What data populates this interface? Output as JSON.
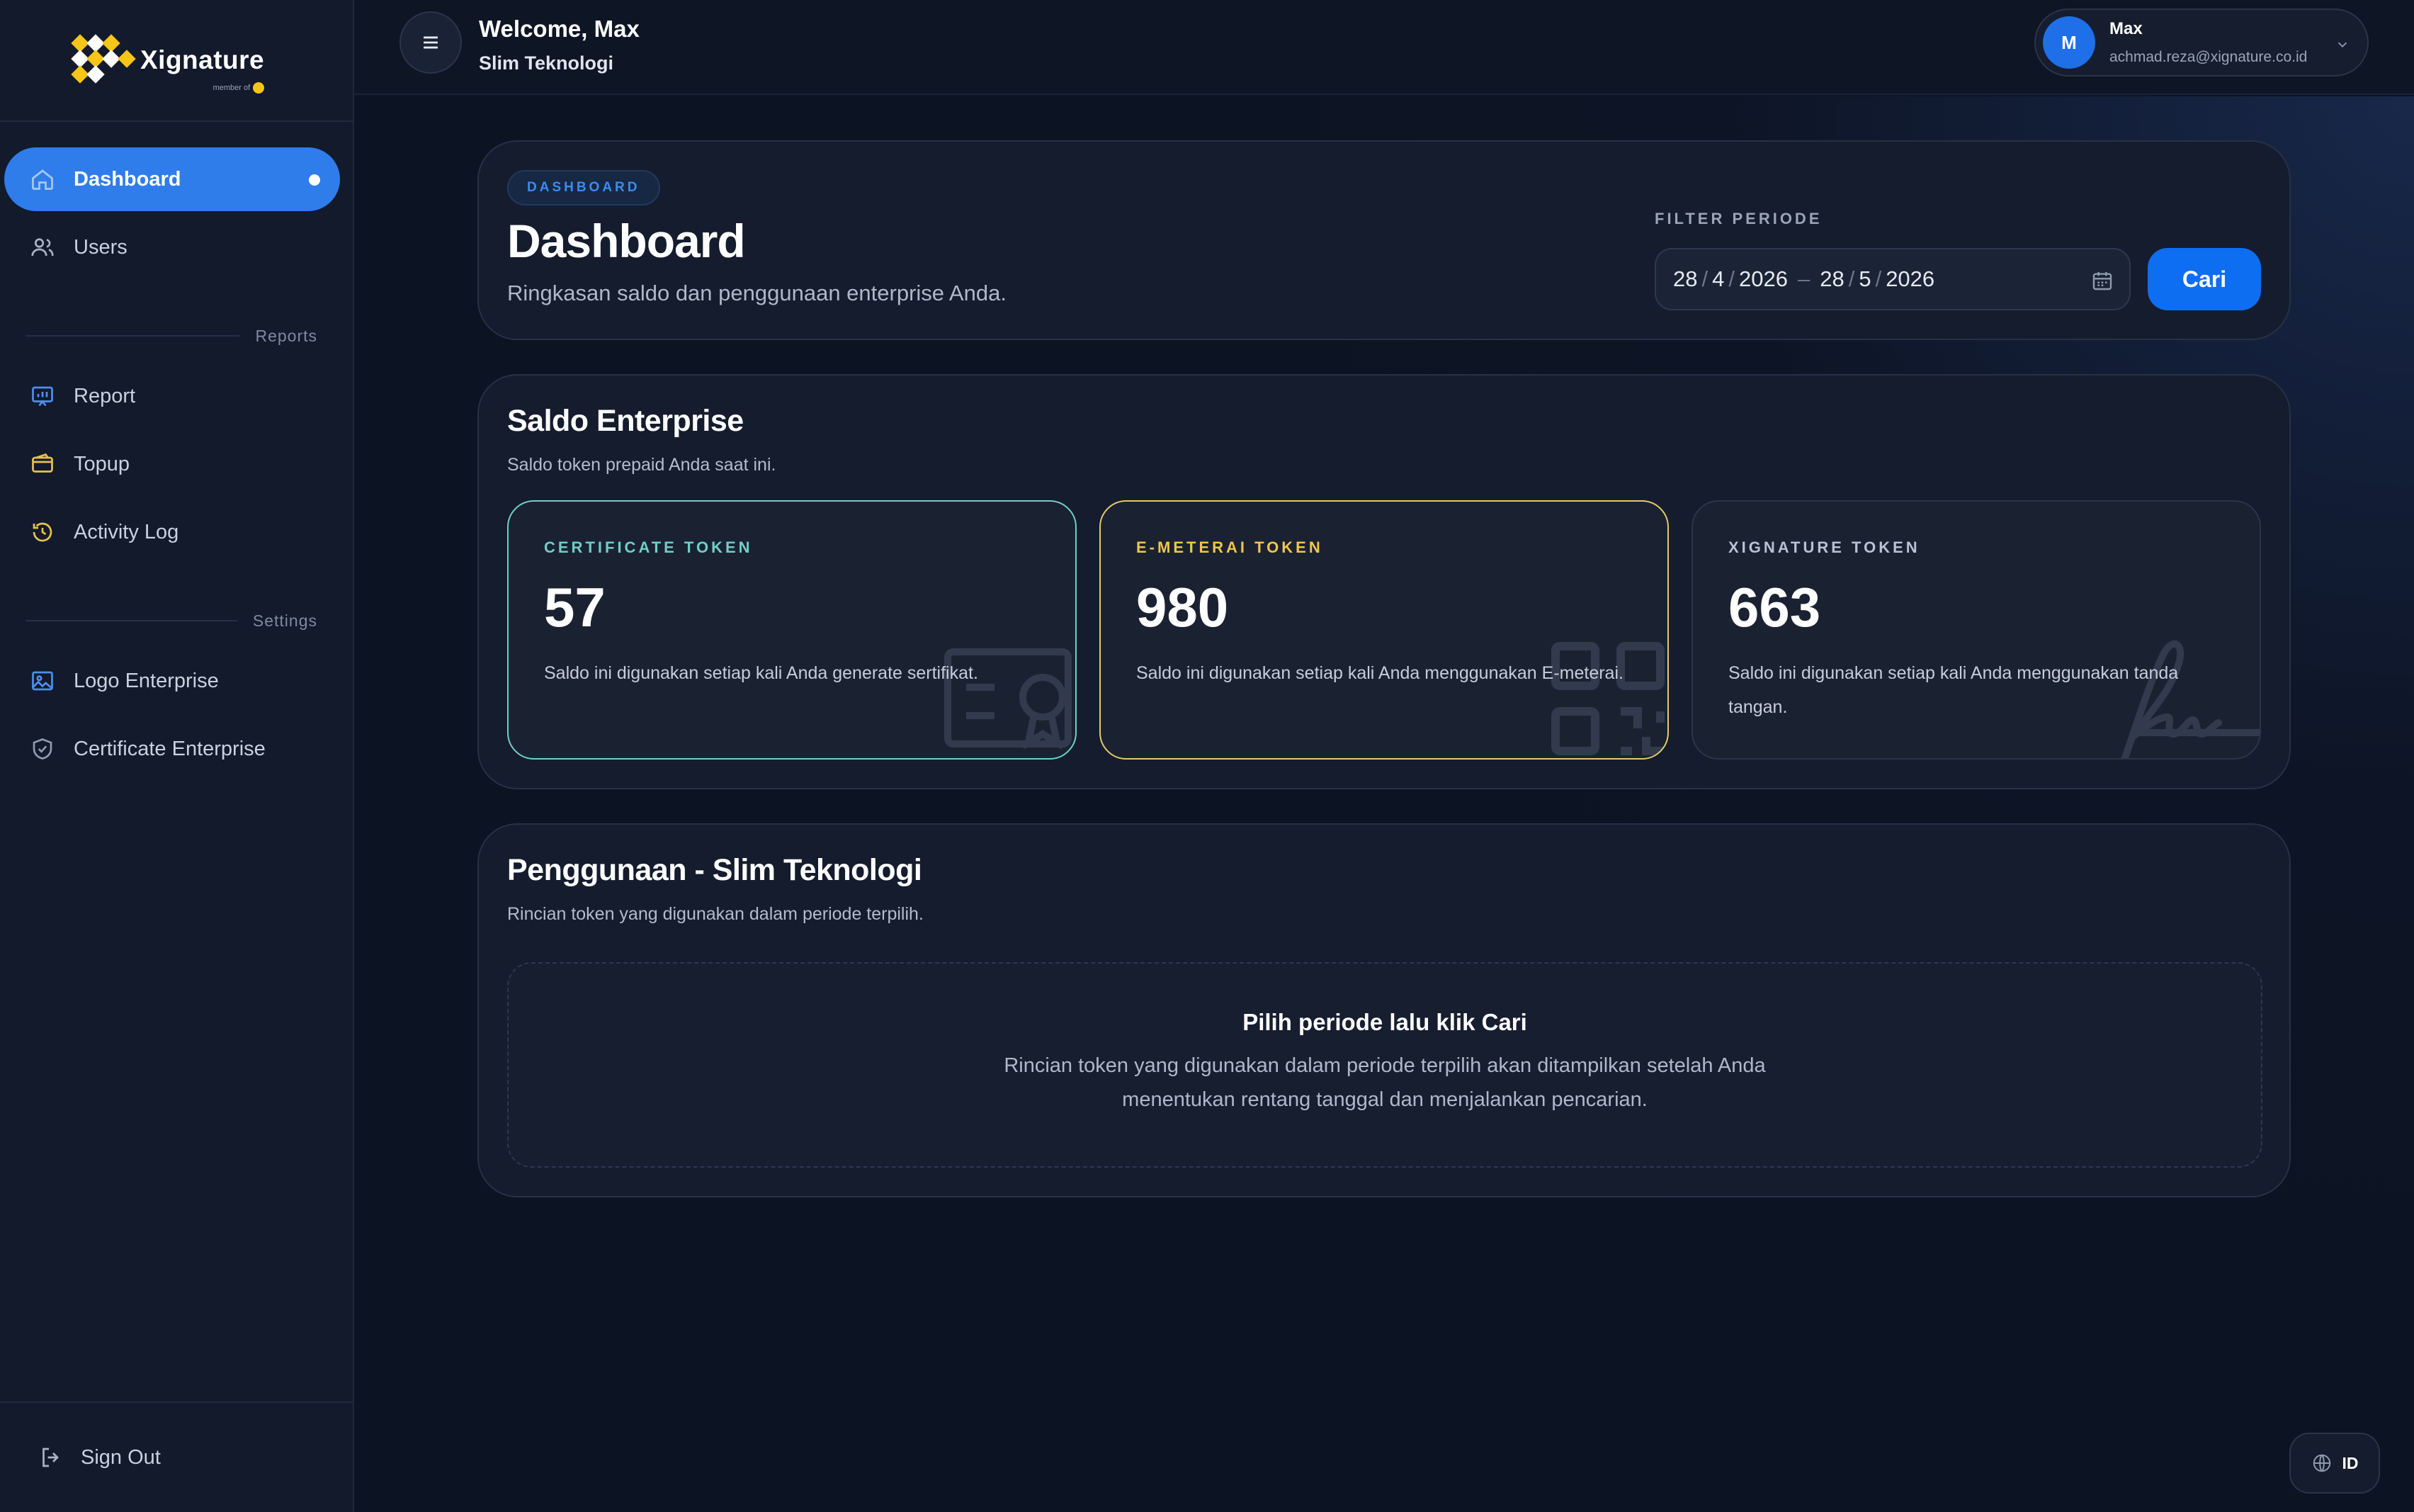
{
  "brand": {
    "name": "Xignature",
    "member_text": "member of"
  },
  "sidebar": {
    "items": [
      {
        "label": "Dashboard",
        "icon": "home-icon",
        "active": true
      },
      {
        "label": "Users",
        "icon": "users-icon"
      }
    ],
    "section_reports": "Reports",
    "reports_items": [
      {
        "label": "Report",
        "icon": "chart-icon"
      },
      {
        "label": "Topup",
        "icon": "wallet-icon"
      },
      {
        "label": "Activity Log",
        "icon": "history-icon"
      }
    ],
    "section_settings": "Settings",
    "settings_items": [
      {
        "label": "Logo Enterprise",
        "icon": "image-icon"
      },
      {
        "label": "Certificate Enterprise",
        "icon": "shield-icon"
      }
    ],
    "sign_out": "Sign Out"
  },
  "topbar": {
    "welcome": "Welcome, Max",
    "company": "Slim Teknologi",
    "user_initial": "M",
    "user_name": "Max",
    "user_email": "achmad.reza@xignature.co.id"
  },
  "header": {
    "pill": "DASHBOARD",
    "title": "Dashboard",
    "subtitle": "Ringkasan saldo dan penggunaan enterprise Anda.",
    "filter_label": "FILTER PERIODE",
    "date_from": {
      "day": "28",
      "month": "4",
      "year": "2026"
    },
    "date_to": {
      "day": "28",
      "month": "5",
      "year": "2026"
    },
    "date_separator": "/",
    "range_separator": "–",
    "search_button": "Cari"
  },
  "saldo": {
    "title": "Saldo Enterprise",
    "subtitle": "Saldo token prepaid Anda saat ini.",
    "tokens": [
      {
        "label": "CERTIFICATE TOKEN",
        "value": "57",
        "desc": "Saldo ini digunakan setiap kali Anda generate sertifikat.",
        "accent": "#6fd0c4"
      },
      {
        "label": "E-METERAI TOKEN",
        "value": "980",
        "desc": "Saldo ini digunakan setiap kali Anda menggunakan E-meterai.",
        "accent": "#f0c64a"
      },
      {
        "label": "XIGNATURE TOKEN",
        "value": "663",
        "desc": "Saldo ini digunakan setiap kali Anda menggunakan tanda tangan.",
        "accent": "#b8c2d2"
      }
    ]
  },
  "usage": {
    "title": "Penggunaan - Slim Teknologi",
    "subtitle": "Rincian token yang digunakan dalam periode terpilih.",
    "empty_title": "Pilih periode lalu klik Cari",
    "empty_desc": "Rincian token yang digunakan dalam periode terpilih akan ditampilkan setelah Anda menentukan rentang tanggal dan menjalankan pencarian."
  },
  "floating": {
    "language": "ID"
  },
  "colors": {
    "primary": "#0d6ef2",
    "sidebar_active": "#2f7dea",
    "background": "#0c1322"
  }
}
